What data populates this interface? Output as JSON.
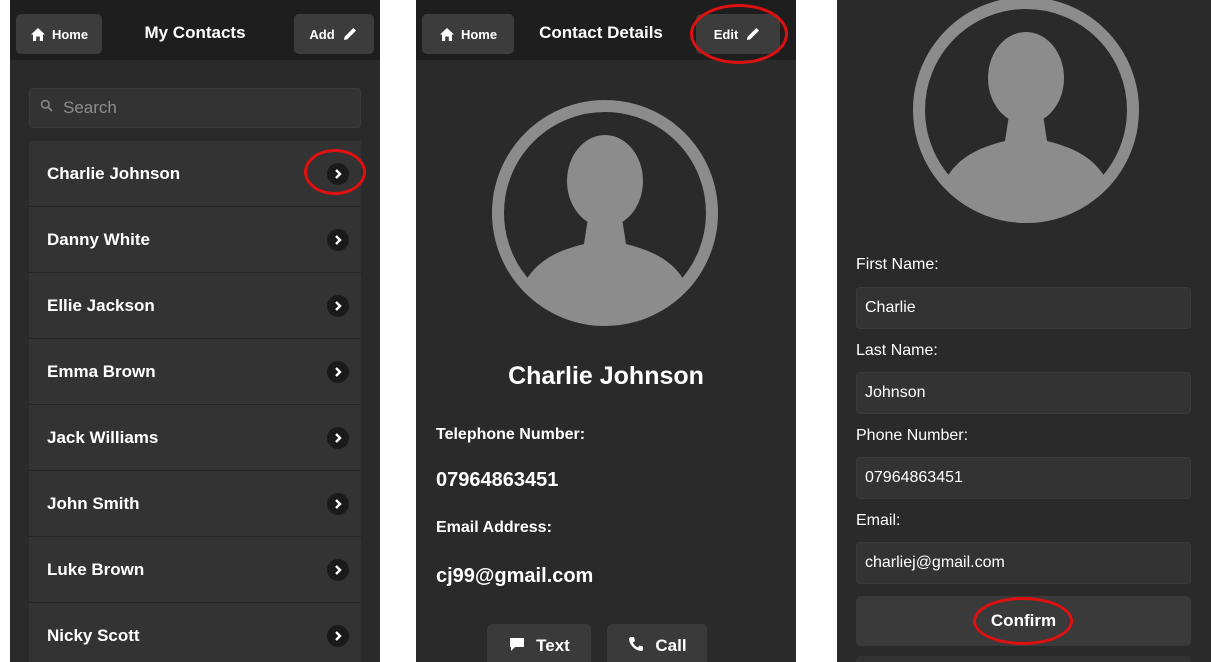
{
  "screen1": {
    "header": {
      "home_label": "Home",
      "title": "My Contacts",
      "add_label": "Add"
    },
    "search": {
      "placeholder": "Search"
    },
    "contacts": [
      "Charlie Johnson",
      "Danny White",
      "Ellie Jackson",
      "Emma Brown",
      "Jack Williams",
      "John Smith",
      "Luke Brown",
      "Nicky Scott"
    ]
  },
  "screen2": {
    "header": {
      "home_label": "Home",
      "title": "Contact Details",
      "edit_label": "Edit"
    },
    "name": "Charlie Johnson",
    "phone_label": "Telephone Number:",
    "phone": "07964863451",
    "email_label": "Email Address:",
    "email": "cj99@gmail.com",
    "text_label": "Text",
    "call_label": "Call"
  },
  "screen3": {
    "first_name_label": "First Name:",
    "first_name": "Charlie",
    "last_name_label": "Last Name:",
    "last_name": "Johnson",
    "phone_label": "Phone Number:",
    "phone": "07964863451",
    "email_label": "Email:",
    "email": "charliej@gmail.com",
    "confirm_label": "Confirm"
  },
  "colors": {
    "background": "#2a2a2a",
    "header": "#1e1e1e",
    "row": "#333333",
    "highlight": "#e01010",
    "avatar": "#8c8c8c"
  },
  "icons": [
    "home-icon",
    "pencil-icon",
    "search-icon",
    "chevron-right-icon",
    "avatar-icon",
    "message-icon",
    "phone-icon"
  ]
}
